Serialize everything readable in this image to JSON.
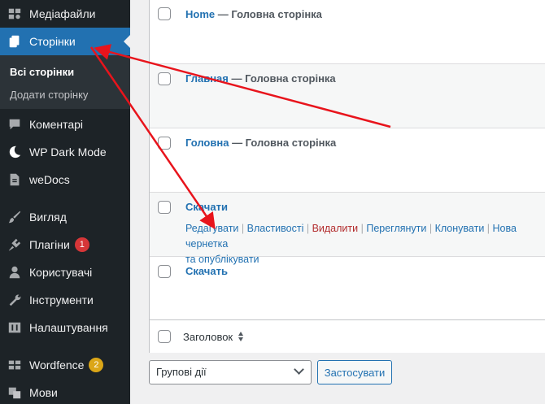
{
  "sidebar": {
    "items": [
      {
        "label": "Медіафайли",
        "icon": "media-icon"
      },
      {
        "label": "Сторінки",
        "icon": "pages-icon"
      },
      {
        "label": "Коментарі",
        "icon": "comments-icon"
      },
      {
        "label": "WP Dark Mode",
        "icon": "moon-icon"
      },
      {
        "label": "weDocs",
        "icon": "docs-icon"
      },
      {
        "label": "Вигляд",
        "icon": "paintbrush-icon"
      },
      {
        "label": "Плагіни",
        "icon": "plugin-icon",
        "badge": "1",
        "badge_color": "#d63638"
      },
      {
        "label": "Користувачі",
        "icon": "user-icon"
      },
      {
        "label": "Інструменти",
        "icon": "wrench-icon"
      },
      {
        "label": "Налаштування",
        "icon": "settings-icon"
      },
      {
        "label": "Wordfence",
        "icon": "wordfence-icon",
        "badge": "2",
        "badge_color": "#dba617"
      },
      {
        "label": "Мови",
        "icon": "translation-icon"
      }
    ],
    "submenu": {
      "all_pages": "Всі сторінки",
      "add_page": "Додати сторінку"
    }
  },
  "table": {
    "rows": [
      {
        "title": "Home",
        "state": " — Головна сторінка"
      },
      {
        "title": "Главная",
        "state": " — Головна сторінка"
      },
      {
        "title": "Головна",
        "state": " — Головна сторінка"
      },
      {
        "title": "Скачати",
        "state": ""
      },
      {
        "title": "Скачать",
        "state": ""
      }
    ],
    "row_actions": {
      "edit": "Редагувати",
      "properties": "Властивості",
      "delete": "Видалити",
      "view": "Переглянути",
      "clone": "Клонувати",
      "new_draft": "Нова чернетка",
      "new_draft_cont": "та опублікувати",
      "separator": " | "
    },
    "footer_column": "Заголовок"
  },
  "bulk_actions": {
    "selected": "Групові дії",
    "apply_label": "Застосувати"
  },
  "colors": {
    "accent": "#2271b1",
    "sidebar_bg": "#1d2327",
    "arrow": "#e8141c"
  }
}
